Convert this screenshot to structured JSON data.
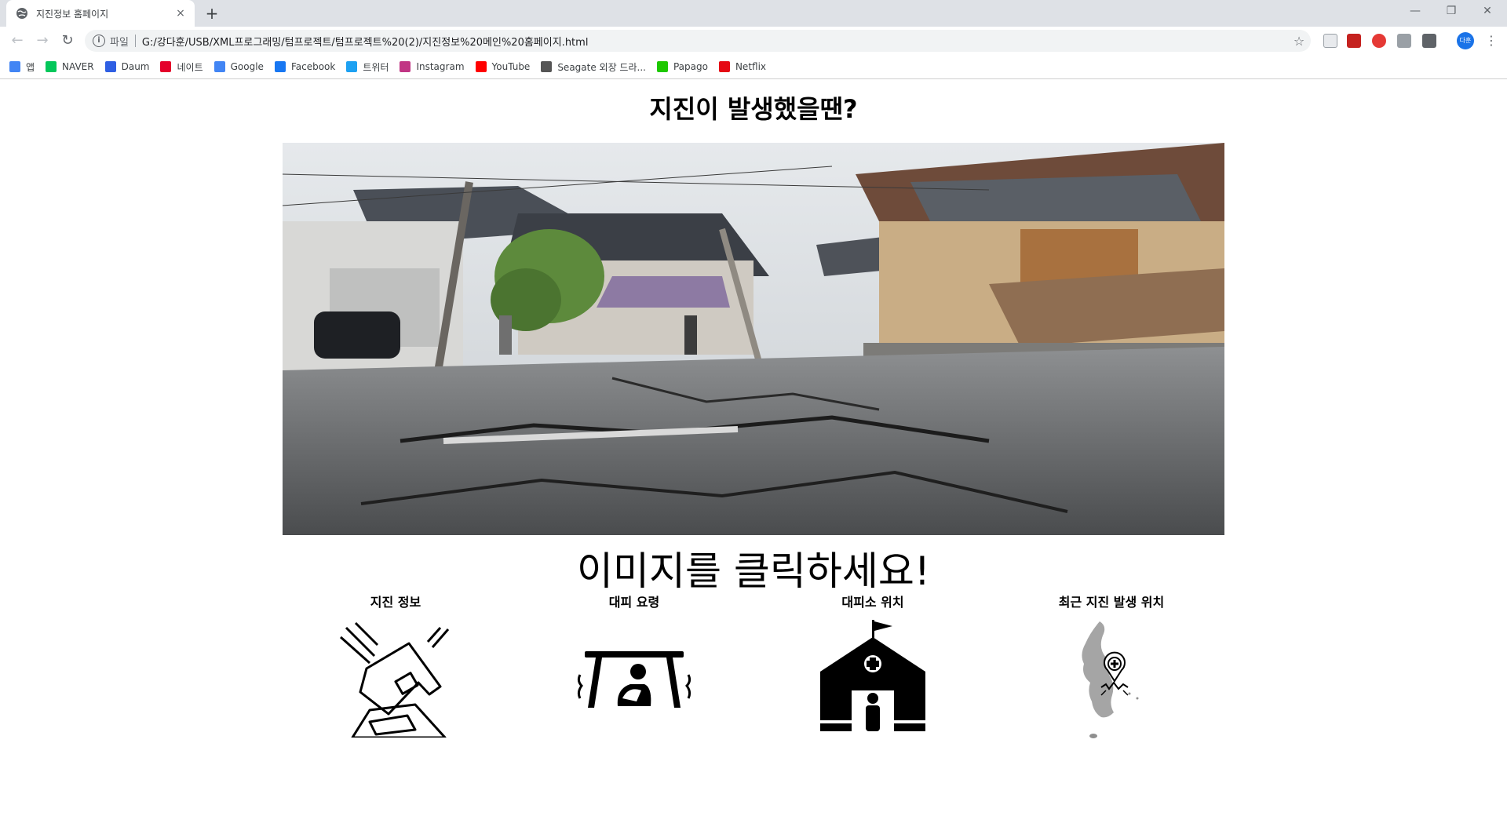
{
  "browser": {
    "tab_title": "지진정보 홈페이지",
    "tab_close": "×",
    "new_tab": "+",
    "scheme_label": "파일",
    "url": "G:/강다훈/USB/XML프로그래밍/텀프로젝트/텀프로젝트%20(2)/지진정보%20메인%20홈페이지.html",
    "profile_initials": "다훈",
    "bookmarks": [
      {
        "label": "앱",
        "icon": "apps-grid-icon",
        "color": "#4285f4"
      },
      {
        "label": "NAVER",
        "icon": "naver-icon",
        "color": "#03c75a"
      },
      {
        "label": "Daum",
        "icon": "daum-icon",
        "color": "#2f5fe3"
      },
      {
        "label": "네이트",
        "icon": "nate-icon",
        "color": "#e4002b"
      },
      {
        "label": "Google",
        "icon": "google-icon",
        "color": "#4285f4"
      },
      {
        "label": "Facebook",
        "icon": "facebook-icon",
        "color": "#1877f2"
      },
      {
        "label": "트위터",
        "icon": "twitter-icon",
        "color": "#1da1f2"
      },
      {
        "label": "Instagram",
        "icon": "instagram-icon",
        "color": "#c13584"
      },
      {
        "label": "YouTube",
        "icon": "youtube-icon",
        "color": "#ff0000"
      },
      {
        "label": "Seagate 외장 드라...",
        "icon": "seagate-icon",
        "color": "#555555"
      },
      {
        "label": "Papago",
        "icon": "papago-icon",
        "color": "#1ec800"
      },
      {
        "label": "Netflix",
        "icon": "netflix-icon",
        "color": "#e50914"
      }
    ]
  },
  "page": {
    "title": "지진이 발생했을땐?",
    "cta": "이미지를 클릭하세요!",
    "cards": [
      {
        "label": "지진 정보",
        "icon": "collapsing-house-icon"
      },
      {
        "label": "대피 요령",
        "icon": "shelter-under-table-icon"
      },
      {
        "label": "대피소 위치",
        "icon": "evacuation-shelter-icon"
      },
      {
        "label": "최근 지진 발생 위치",
        "icon": "earthquake-location-map-icon"
      }
    ]
  }
}
